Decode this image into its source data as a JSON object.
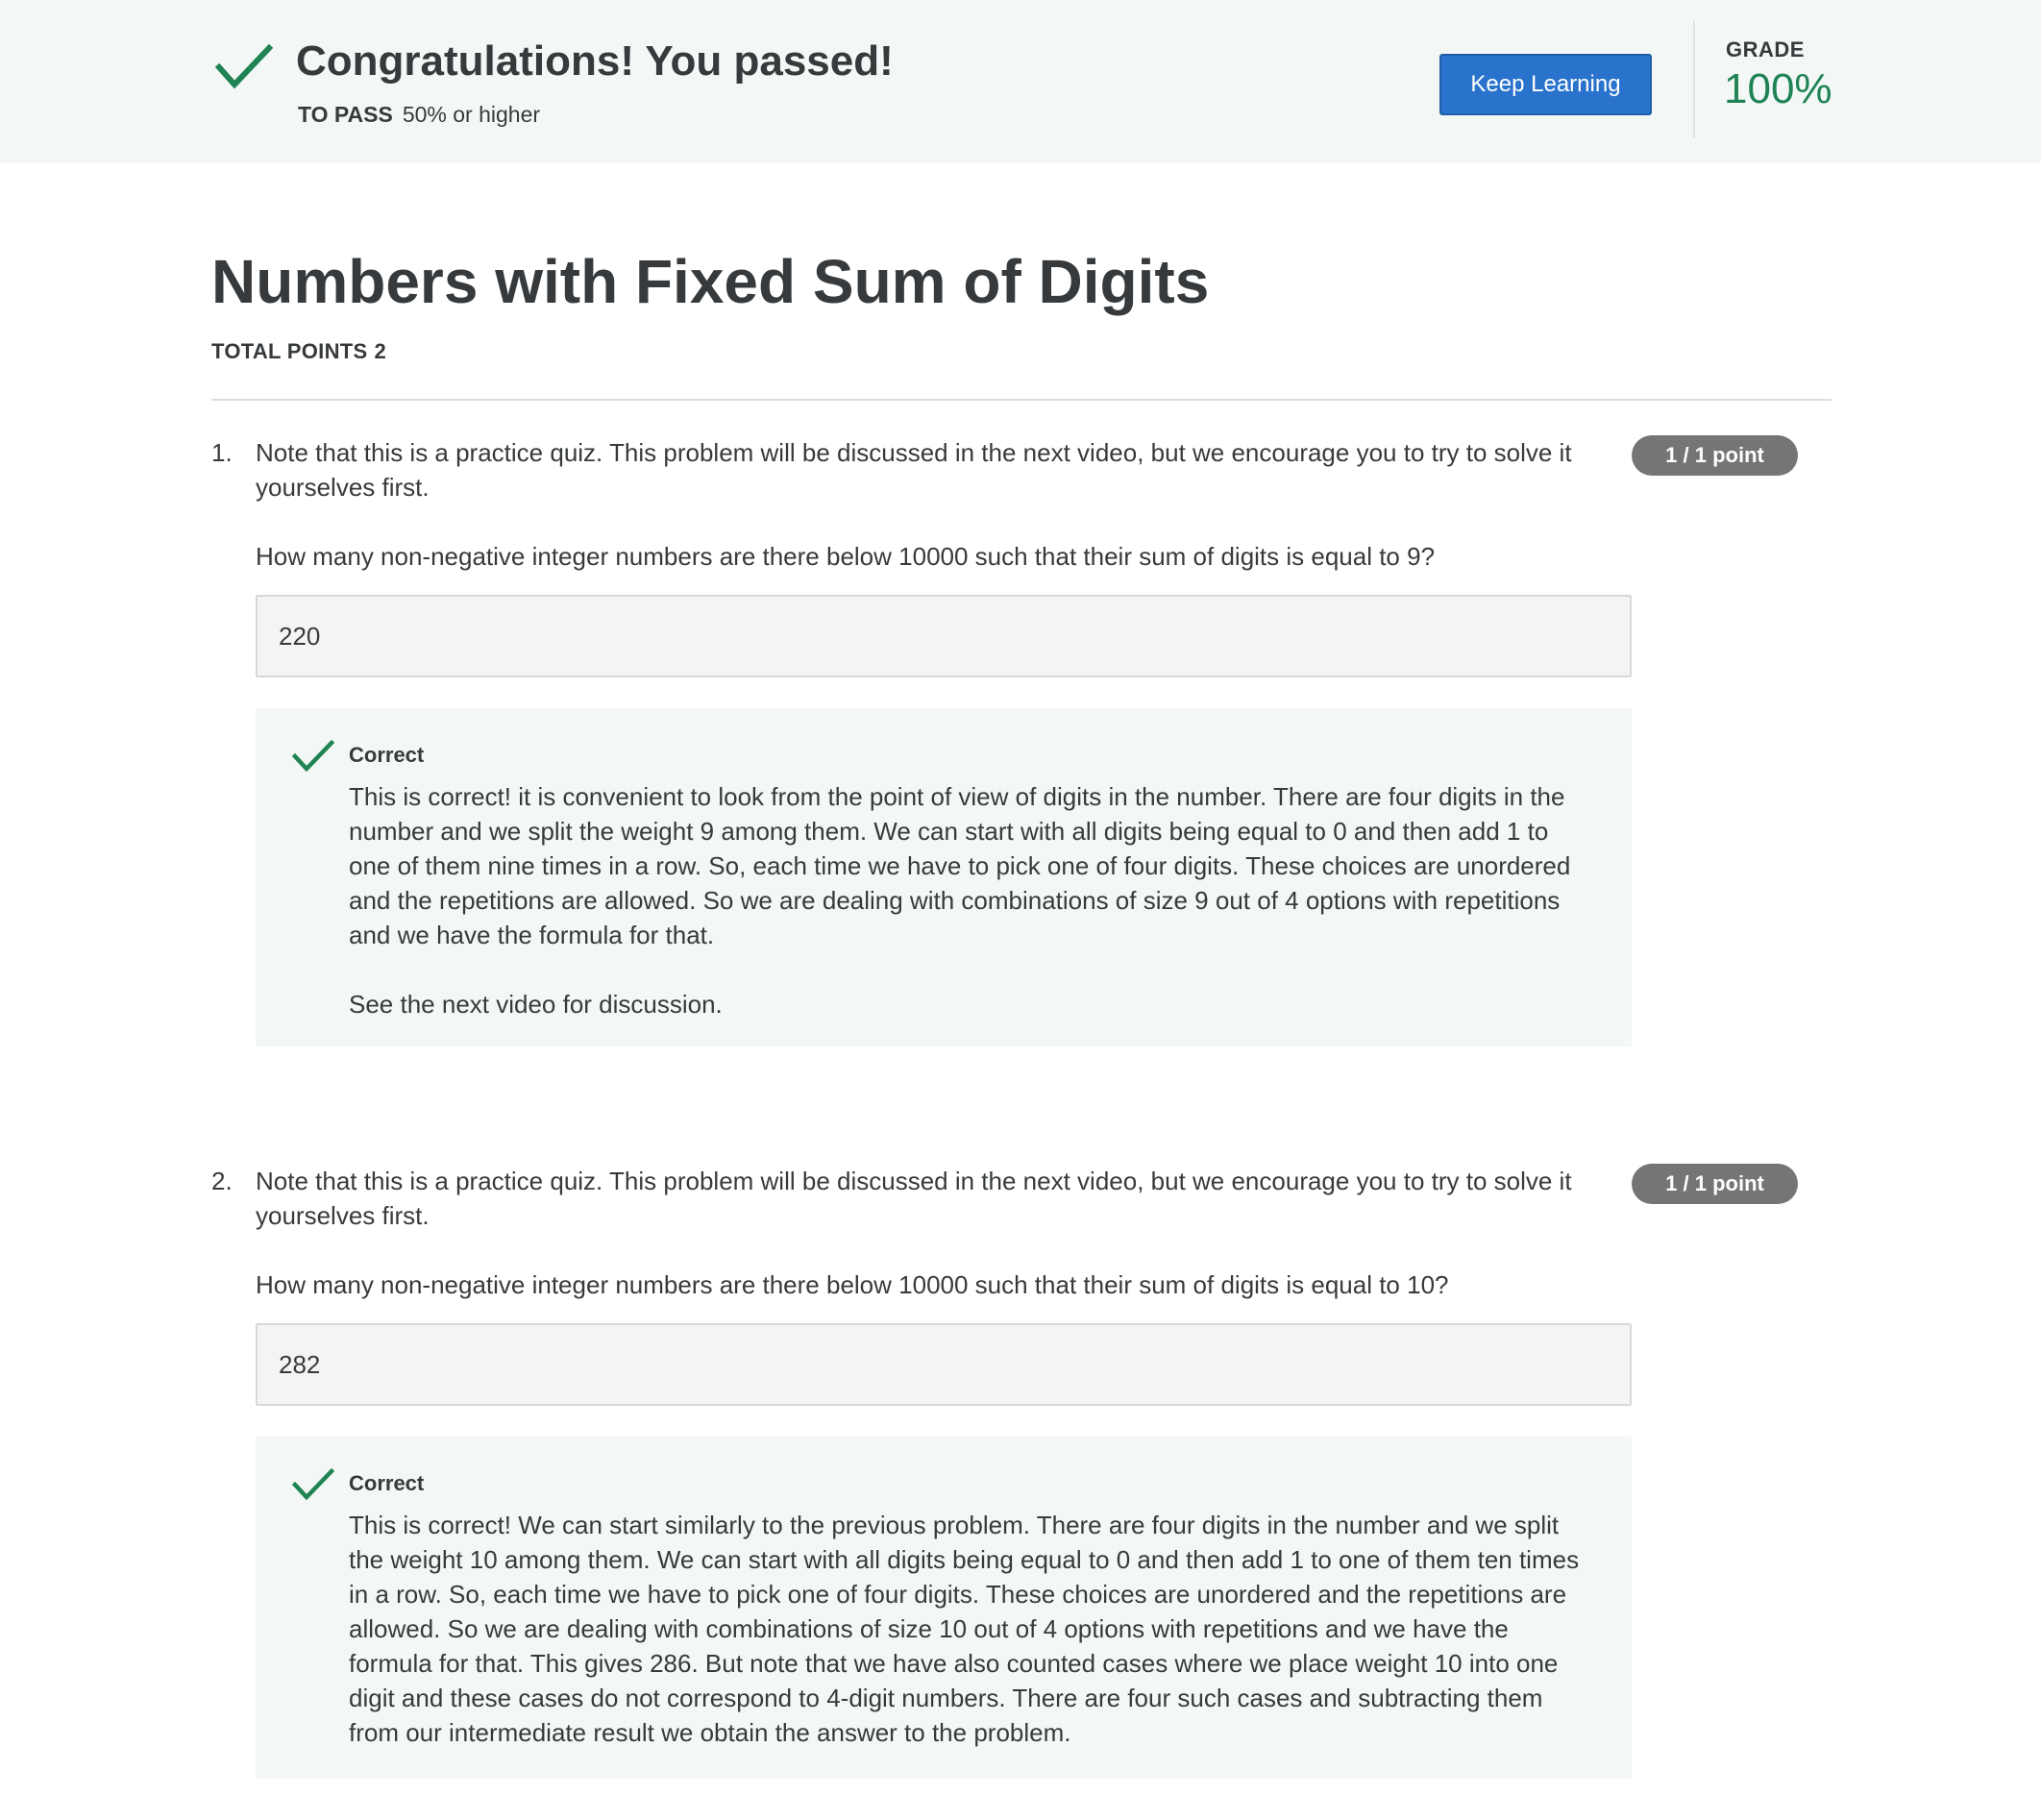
{
  "banner": {
    "check_icon": "checkmark-icon",
    "title": "Congratulations! You passed!",
    "to_pass_label": "TO PASS",
    "to_pass_value": "50% or higher",
    "keep_learning_label": "Keep Learning",
    "grade_label": "GRADE",
    "grade_value": "100%",
    "colors": {
      "success": "#1f8354",
      "button": "#2a73cc",
      "banner_bg": "#f3f8f6"
    }
  },
  "quiz": {
    "title": "Numbers with Fixed Sum of Digits",
    "total_points_label": "TOTAL POINTS",
    "total_points_value": "2"
  },
  "questions": [
    {
      "number": "1.",
      "intro": "Note that this is a practice quiz. This problem will be discussed in the next video, but we encourage you to try to solve it yourselves first.",
      "prompt": "How many non-negative integer numbers are there below 10000 such that their sum of digits is equal to 9?",
      "points_badge": "1 / 1 point",
      "answer": "220",
      "feedback": {
        "icon": "checkmark-icon",
        "label": "Correct",
        "text": "This is correct! it is convenient to look from the point of view of digits in the number. There are four digits in the number and we split the weight 9 among them. We can start with all digits being equal to 0 and then add 1 to one of them nine times in a row. So, each time we have to pick one of four digits. These choices are unordered and the repetitions are allowed. So we are dealing with combinations of size 9 out of 4 options with repetitions and we have the formula for that.",
        "extra": "See the next video for discussion."
      }
    },
    {
      "number": "2.",
      "intro": "Note that this is a practice quiz. This problem will be discussed in the next video, but we encourage you to try to solve it yourselves first.",
      "prompt": "How many non-negative integer numbers are there below 10000 such that their sum of digits is equal to 10?",
      "points_badge": "1 / 1 point",
      "answer": "282",
      "feedback": {
        "icon": "checkmark-icon",
        "label": "Correct",
        "text": "This is correct! We can start similarly to the previous problem. There are four digits in the number and we split the weight 10 among them. We can start with all digits being equal to 0 and then add 1 to one of them ten times in a row. So, each time we have to pick one of four digits. These choices are unordered and the repetitions are allowed. So we are dealing with combinations of size 10 out of 4 options with repetitions and we have the formula for that. This gives 286. But note that we have also counted cases where we place weight 10 into one digit and these cases do not correspond to 4-digit numbers. There are four such cases and subtracting them from our intermediate result we obtain the answer to the problem."
      }
    }
  ]
}
